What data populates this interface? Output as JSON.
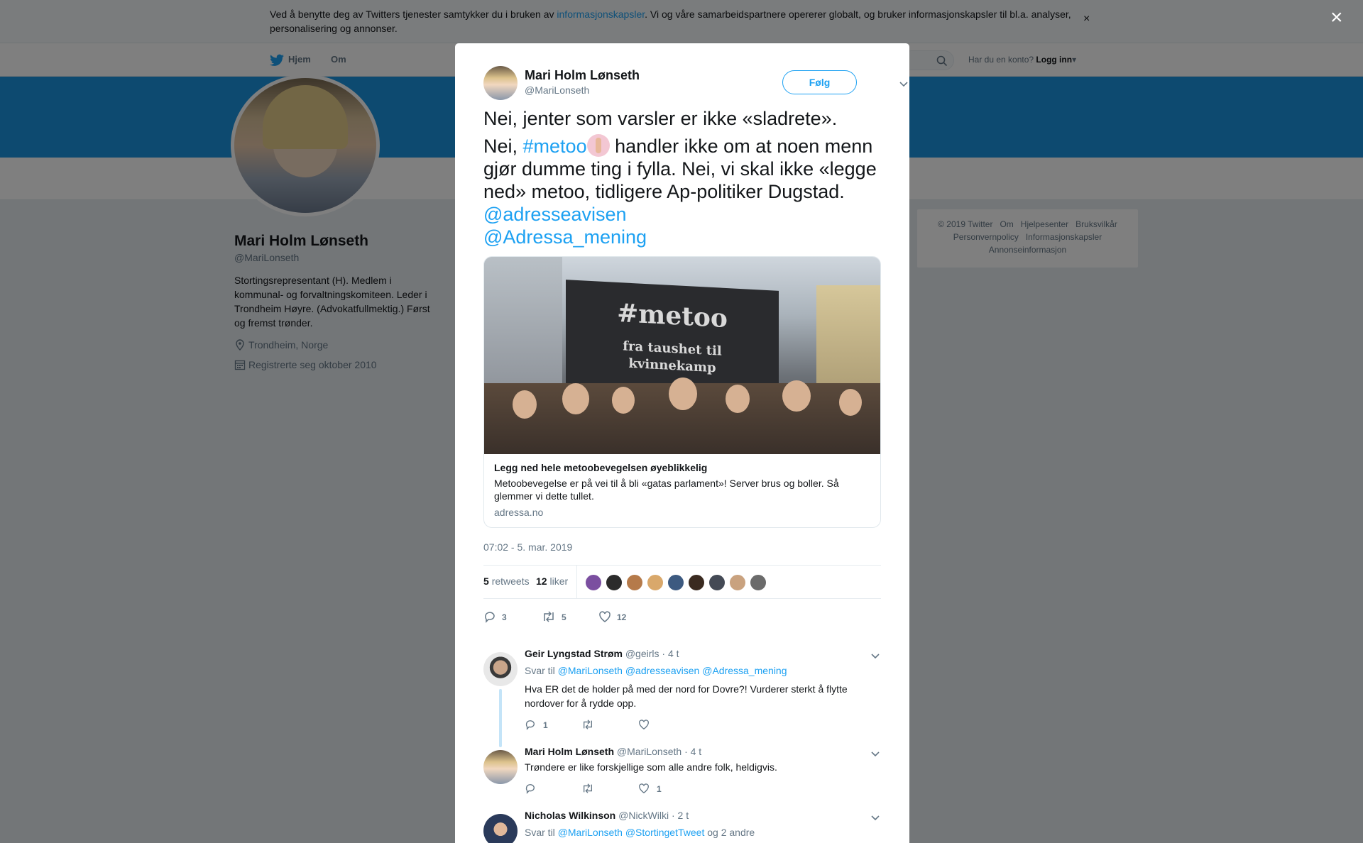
{
  "cookie": {
    "text_before": "Ved å benytte deg av Twitters tjenester samtykker du i bruken av ",
    "link": "informasjonskapsler",
    "text_after": ". Vi og våre samarbeidspartnere opererer globalt, og bruker informasjonskapsler til bl.a. analyser, personalisering og annonser.",
    "close": "×"
  },
  "nav": {
    "home": "Hjem",
    "about": "Om",
    "account_prompt": "Har du en konto?",
    "login": "Logg inn"
  },
  "profile": {
    "name": "Mari Holm Lønseth",
    "handle": "@MariLonseth",
    "bio": "Stortingsrepresentant (H). Medlem i kommunal- og forvaltningskomiteen. Leder i Trondheim Høyre. (Advokatfullmektig.) Først og fremst trønder.",
    "location": "Trondheim, Norge",
    "joined": "Registrerte seg oktober 2010"
  },
  "footer": {
    "links": [
      "© 2019 Twitter",
      "Om",
      "Hjelpesenter",
      "Bruksvilkår",
      "Personvernpolicy",
      "Informasjonskapsler",
      "Annonseinformasjon"
    ]
  },
  "modal": {
    "close": "×",
    "tweet": {
      "author_name": "Mari Holm Lønseth",
      "author_handle": "@MariLonseth",
      "follow": "Følg",
      "line1": "Nei, jenter som varsler er ikke «sladrete».",
      "nei": "Nei, ",
      "hashtag": "#metoo",
      "line2_rest": " handler ikke om at noen menn gjør dumme ting i fylla. Nei, vi skal ikke «legge ned» metoo, tidligere Ap-politiker Dugstad. ",
      "mention1": "@adresseavisen",
      "mention2": "@Adressa_mening",
      "card": {
        "banner_title": "#metoo",
        "banner_sub1": "fra taushet til",
        "banner_sub2": "kvinnekamp",
        "title": "Legg ned hele metoobevegelsen øyeblikkelig",
        "description": "Metoobevegelse er på vei til å bli «gatas parlament»! Server brus og boller. Så glemmer vi dette tullet.",
        "domain": "adressa.no"
      },
      "timestamp": "07:02 - 5. mar. 2019",
      "retweets_count": "5",
      "retweets_label": "retweets",
      "likes_count": "12",
      "likes_label": "liker",
      "likers": [
        "#7b4fa0",
        "#2b2b2b",
        "#b57a4a",
        "#d9a86b",
        "#3d5a80",
        "#3a2a20",
        "#444a55",
        "#c9a27f",
        "#6b6b6b"
      ],
      "actions": {
        "replies": "3",
        "retweets": "5",
        "likes": "12"
      }
    },
    "replies": [
      {
        "name": "Geir Lyngstad Strøm",
        "handle": "@geirls",
        "time": "· 4 t",
        "to_label": "Svar til",
        "to": [
          "@MariLonseth",
          "@adresseavisen",
          "@Adressa_mening"
        ],
        "text": "Hva ER det de holder på med der nord for Dovre?! Vurderer sterkt å flytte nordover for å rydde opp.",
        "replies": "1",
        "retweets": "",
        "likes": ""
      },
      {
        "name": "Mari Holm Lønseth",
        "handle": "@MariLonseth",
        "time": "· 4 t",
        "text": "Trøndere er like forskjellige som alle andre folk, heldigvis.",
        "replies": "",
        "retweets": "",
        "likes": "1"
      },
      {
        "name": "Nicholas Wilkinson",
        "handle": "@NickWilki",
        "time": "· 2 t",
        "to_label": "Svar til",
        "to": [
          "@MariLonseth",
          "@StortingetTweet"
        ],
        "to_suffix": "og 2 andre"
      }
    ]
  }
}
